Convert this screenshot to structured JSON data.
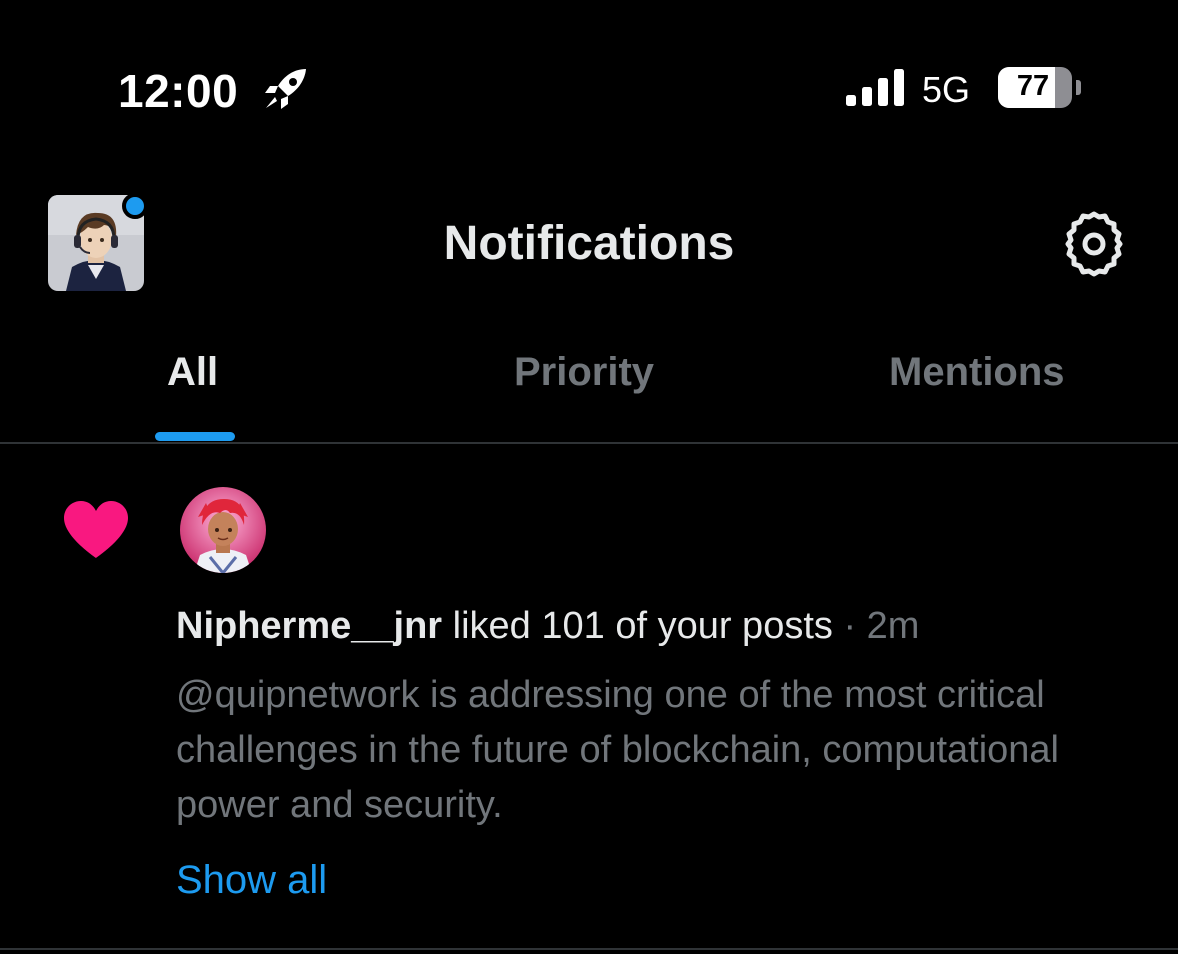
{
  "status_bar": {
    "time": "12:00",
    "network": "5G",
    "battery_percent": "77",
    "battery_level": 0.77,
    "icons": [
      "rocket-icon",
      "signal-icon",
      "battery-icon"
    ]
  },
  "header": {
    "title": "Notifications",
    "avatar_icon": "user-avatar",
    "settings_icon": "gear-icon"
  },
  "tabs": [
    {
      "label": "All",
      "active": true
    },
    {
      "label": "Priority",
      "active": false
    },
    {
      "label": "Mentions",
      "active": false
    }
  ],
  "notification": {
    "type_icon": "heart-icon",
    "user": "Nipherme__jnr",
    "action": "liked 101 of your posts",
    "time": "· 2m",
    "preview": "@quipnetwork is addressing one of the most critical challenges in the future of blockchain, computational power and security.",
    "show_all": "Show all"
  },
  "colors": {
    "background": "#000000",
    "accent": "#1d9bf0",
    "like": "#f91880",
    "muted": "#71767b",
    "text": "#e7e9ea"
  }
}
